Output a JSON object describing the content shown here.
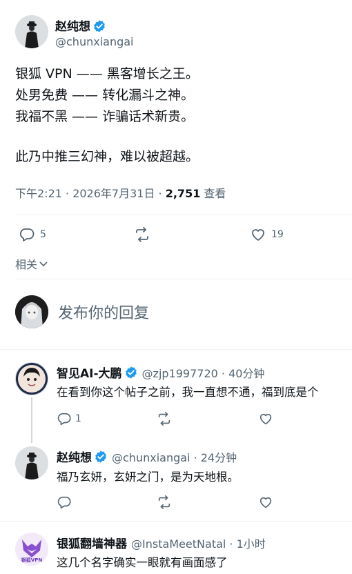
{
  "author": {
    "name": "赵纯想",
    "handle": "@chunxiangai"
  },
  "post": {
    "lines": [
      "银狐 VPN —— 黑客增长之王。",
      "处男免费 —— 转化漏斗之神。",
      "我福不黑 —— 诈骗话术新贵。",
      "此乃中推三幻神，难以被超越。"
    ],
    "time": "下午2:21 · 2026年7月31日 · ",
    "views_count": "2,751",
    "views_label": " 查看"
  },
  "actions": {
    "reply_count": "5",
    "like_count": "19"
  },
  "related_label": "相关",
  "compose": {
    "placeholder": "发布你的回复"
  },
  "replies": [
    {
      "name": "智见AI-大鹏",
      "handle": "@zjp1997720 · 40分钟",
      "text": "在看到你这个帖子之前，我一直想不通，福到底是个",
      "reply_count": "1",
      "like_count": ""
    },
    {
      "name": "赵纯想",
      "handle": "@chunxiangai · 24分钟",
      "text": "福乃玄妍，玄妍之门，是为天地根。",
      "reply_count": "",
      "like_count": ""
    },
    {
      "name": "银狐翻墙神器",
      "handle": "@InstaMeetNatal · 1小时",
      "text": "这几个名字确实一眼就有画面感了",
      "avatar_text": "银狐VPN"
    }
  ],
  "colors": {
    "accent": "#1d9bf0",
    "muted": "#536471",
    "divider": "#eff3f4"
  }
}
